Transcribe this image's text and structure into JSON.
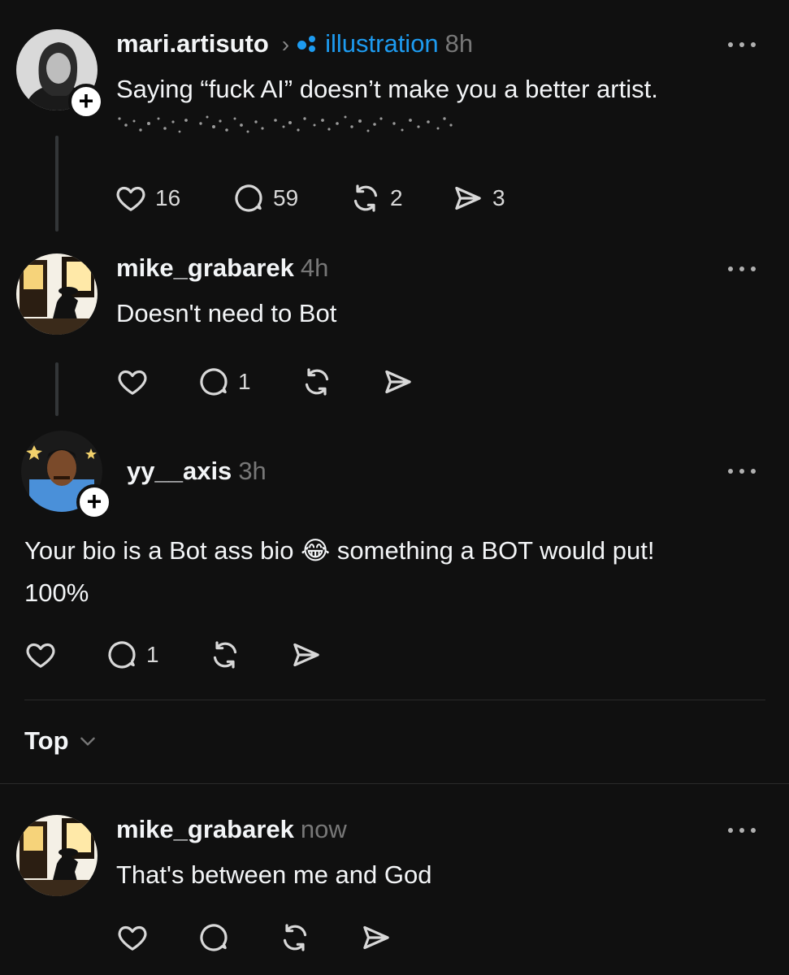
{
  "posts": [
    {
      "username": "mari.artisuto",
      "topic": "illustration",
      "time": "8h",
      "text": "Saying “fuck AI” doesn’t make you a better artist.",
      "counts": {
        "likes": "16",
        "replies": "59",
        "reposts": "2",
        "shares": "3"
      }
    },
    {
      "username": "mike_grabarek",
      "time": "4h",
      "text": "Doesn't need to Bot",
      "counts": {
        "replies": "1"
      }
    },
    {
      "username": "yy__axis",
      "time": "3h",
      "text_line1": "Your bio is a Bot ass bio 😂 something a BOT would put!",
      "text_line2": "100%",
      "counts": {
        "replies": "1"
      }
    },
    {
      "username": "mike_grabarek",
      "time": "now",
      "text": "That's between me and God"
    }
  ],
  "sort": {
    "label": "Top"
  },
  "colors": {
    "background": "#101010",
    "text": "#f3f5f7",
    "muted": "#777777",
    "accent": "#1d9bf0"
  },
  "icons": [
    "heart-icon",
    "comment-icon",
    "repost-icon",
    "share-icon",
    "more-icon",
    "plus-icon",
    "chevron-down-icon",
    "topic-dots-icon"
  ]
}
